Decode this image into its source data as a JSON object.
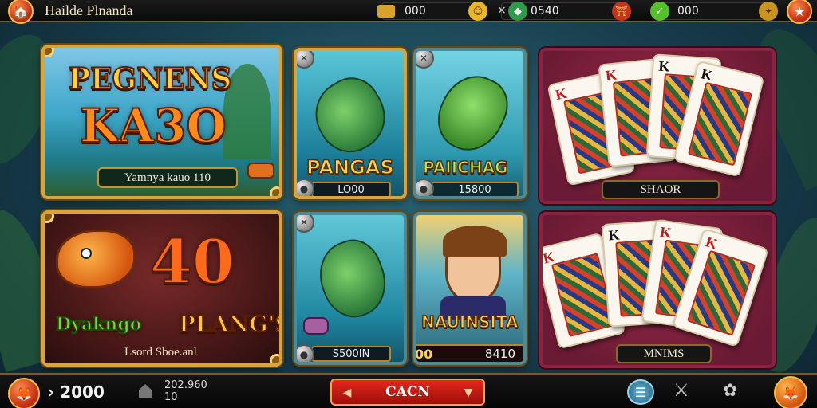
{
  "header": {
    "title": "Hailde Plnanda",
    "resources": [
      {
        "icon": "gold-bar-icon",
        "value": "000",
        "end_icon": "smiley-coin-icon"
      },
      {
        "icon": "green-gem-icon",
        "prefix": "×",
        "value": "0540",
        "end_icon": "lantern-icon"
      },
      {
        "icon": "green-check-icon",
        "value": "000",
        "end_icon": "gold-medal-icon"
      }
    ]
  },
  "games": {
    "promo_top": {
      "title_line1": "PEGNENS",
      "title_line2": "KA3O",
      "caption": "Yamnya kauo 110"
    },
    "promo_bottom": {
      "number": "40",
      "word_green": "Dyakngo",
      "word_gold": "PLANG'S",
      "caption": "Lsord Sboe.anl"
    },
    "tile1": {
      "label": "PANGAS",
      "value": "LO00"
    },
    "tile2": {
      "label": "PAIICHAG",
      "value": "15800"
    },
    "tile3": {
      "value": "S500IN"
    },
    "tile4": {
      "label": "NAUINSITA",
      "value_left": "00",
      "value_right": "8410"
    },
    "cards_top": {
      "caption": "SHAOR",
      "ranks": [
        "K",
        "K",
        "K",
        "K"
      ]
    },
    "cards_bottom": {
      "caption": "MNIMS",
      "ranks": [
        "K",
        "K",
        "K",
        "K"
      ]
    }
  },
  "footer": {
    "balance": "› 2000",
    "counter_top": "202.960",
    "counter_bottom": "10",
    "cta_label": "CACN"
  },
  "colors": {
    "accent_gold": "#d9a43c",
    "cta_red": "#e5271d",
    "card_panel": "#7a1d3a"
  }
}
